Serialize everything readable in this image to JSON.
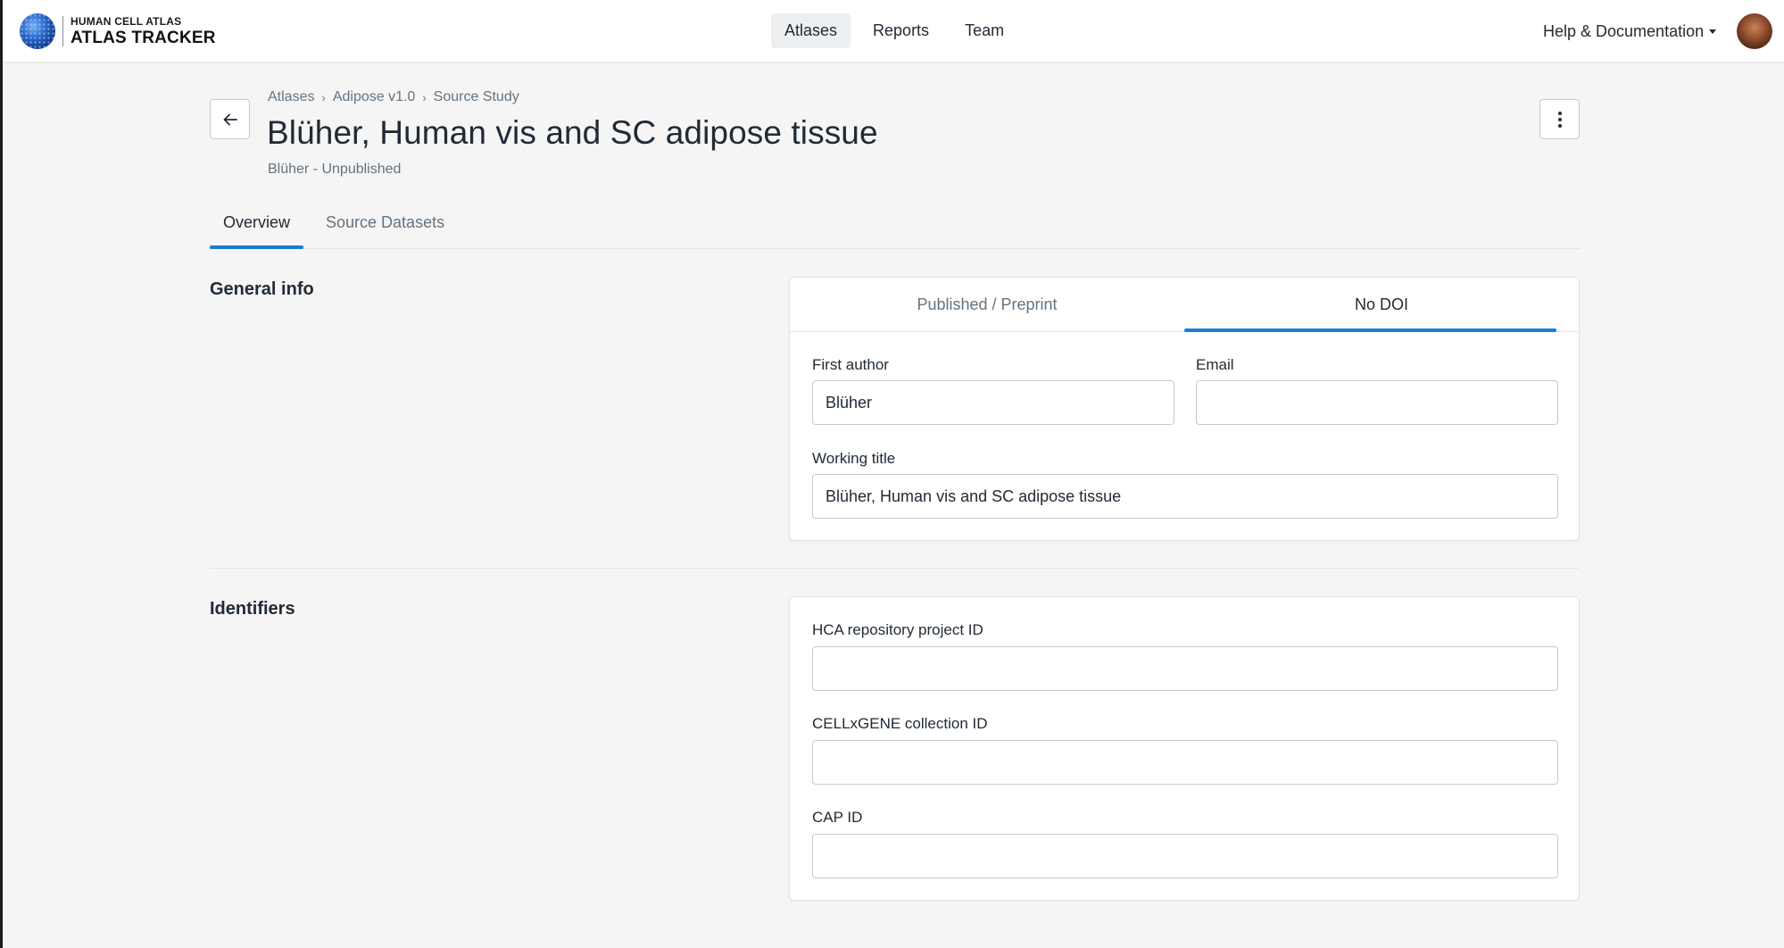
{
  "header": {
    "logo_small": "HUMAN CELL ATLAS",
    "logo_big": "ATLAS TRACKER",
    "nav": [
      {
        "label": "Atlases",
        "active": true
      },
      {
        "label": "Reports",
        "active": false
      },
      {
        "label": "Team",
        "active": false
      }
    ],
    "help_label": "Help & Documentation"
  },
  "breadcrumb": [
    "Atlases",
    "Adipose v1.0",
    "Source Study"
  ],
  "page": {
    "title": "Blüher, Human vis and SC adipose tissue",
    "subtitle": "Blüher - Unpublished"
  },
  "tabs": [
    {
      "label": "Overview",
      "active": true
    },
    {
      "label": "Source Datasets",
      "active": false
    }
  ],
  "general_info": {
    "title": "General info",
    "card_tabs": [
      {
        "label": "Published / Preprint",
        "active": false
      },
      {
        "label": "No DOI",
        "active": true
      }
    ],
    "first_author": {
      "label": "First author",
      "value": "Blüher"
    },
    "email": {
      "label": "Email",
      "value": ""
    },
    "working_title": {
      "label": "Working title",
      "value": "Blüher, Human vis and SC adipose tissue"
    }
  },
  "identifiers": {
    "title": "Identifiers",
    "hca_id": {
      "label": "HCA repository project ID",
      "value": ""
    },
    "cellxgene_id": {
      "label": "CELLxGENE collection ID",
      "value": ""
    },
    "cap_id": {
      "label": "CAP ID",
      "value": ""
    }
  },
  "colors": {
    "accent": "#1c7cd5",
    "text": "#212b36",
    "muted": "#637381",
    "background": "#f5f5f5"
  }
}
